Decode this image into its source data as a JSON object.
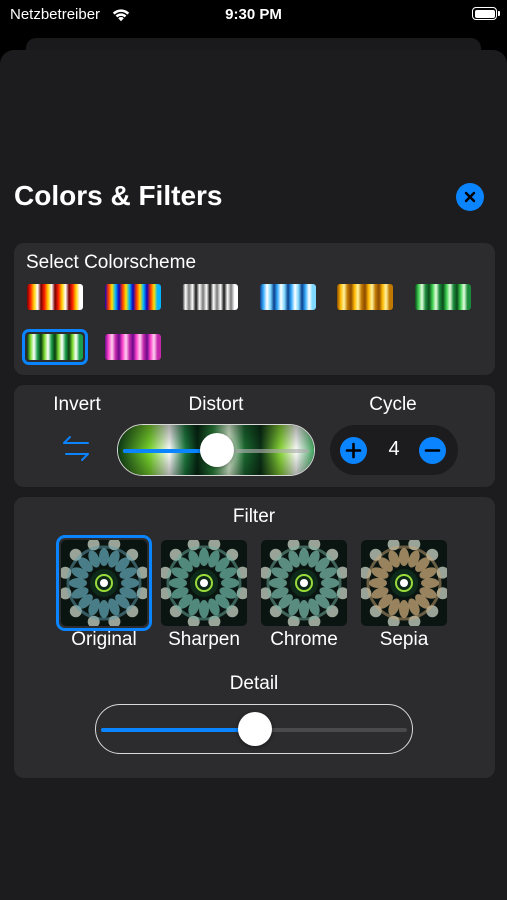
{
  "status_bar": {
    "carrier": "Netzbetreiber",
    "time": "9:30 PM"
  },
  "sheet": {
    "title": "Colors & Filters"
  },
  "colorscheme": {
    "label": "Select Colorscheme",
    "selected_index": 6,
    "schemes": [
      {
        "name": "fire",
        "colors": [
          "#7a0000",
          "#ff2200",
          "#ffd000",
          "#ffffff"
        ]
      },
      {
        "name": "rainbow",
        "colors": [
          "#1400b8",
          "#ff3a00",
          "#ffe000",
          "#00b4ff"
        ]
      },
      {
        "name": "grayscale",
        "colors": [
          "#141414",
          "#ffffff",
          "#7a7a7a",
          "#ffffff"
        ]
      },
      {
        "name": "ice",
        "colors": [
          "#0a3f8c",
          "#3ab0ff",
          "#ffffff",
          "#7fd8ff"
        ]
      },
      {
        "name": "gold",
        "colors": [
          "#8a4a00",
          "#ffb800",
          "#fff4a0",
          "#c07800"
        ]
      },
      {
        "name": "mint",
        "colors": [
          "#0a4a1a",
          "#3cd050",
          "#e6ffe0",
          "#1a8a3a"
        ]
      },
      {
        "name": "lime",
        "colors": [
          "#0a3a10",
          "#7adc30",
          "#ffffff",
          "#1aa04a"
        ]
      },
      {
        "name": "magenta",
        "colors": [
          "#6a0a8a",
          "#ff44cc",
          "#ffd0f0",
          "#c428aa"
        ]
      }
    ]
  },
  "controls": {
    "invert_label": "Invert",
    "distort_label": "Distort",
    "distort_value": 0.5,
    "cycle_label": "Cycle",
    "cycle_value": "4"
  },
  "filter": {
    "label": "Filter",
    "selected_index": 0,
    "options": [
      {
        "label": "Original",
        "tint": "#5fa0b0"
      },
      {
        "label": "Sharpen",
        "tint": "#6ab0a0"
      },
      {
        "label": "Chrome",
        "tint": "#76b4a4"
      },
      {
        "label": "Sepia",
        "tint": "#c8a878"
      }
    ],
    "detail_label": "Detail",
    "detail_value": 0.5
  },
  "colors": {
    "accent": "#0a84ff",
    "panel": "#2c2c2e",
    "sheet": "#1c1c1e"
  },
  "icons": {
    "close": "xmark-circle-fill-icon",
    "invert": "arrow-left-arrow-right-icon",
    "increment": "plus-circle-fill-icon",
    "decrement": "minus-circle-fill-icon"
  }
}
